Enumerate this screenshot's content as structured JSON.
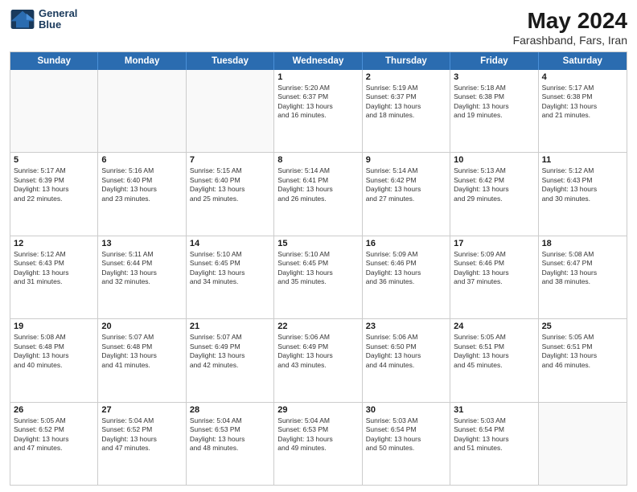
{
  "logo": {
    "line1": "General",
    "line2": "Blue"
  },
  "title": "May 2024",
  "location": "Farashband, Fars, Iran",
  "days_of_week": [
    "Sunday",
    "Monday",
    "Tuesday",
    "Wednesday",
    "Thursday",
    "Friday",
    "Saturday"
  ],
  "weeks": [
    [
      {
        "day": "",
        "info": ""
      },
      {
        "day": "",
        "info": ""
      },
      {
        "day": "",
        "info": ""
      },
      {
        "day": "1",
        "info": "Sunrise: 5:20 AM\nSunset: 6:37 PM\nDaylight: 13 hours\nand 16 minutes."
      },
      {
        "day": "2",
        "info": "Sunrise: 5:19 AM\nSunset: 6:37 PM\nDaylight: 13 hours\nand 18 minutes."
      },
      {
        "day": "3",
        "info": "Sunrise: 5:18 AM\nSunset: 6:38 PM\nDaylight: 13 hours\nand 19 minutes."
      },
      {
        "day": "4",
        "info": "Sunrise: 5:17 AM\nSunset: 6:38 PM\nDaylight: 13 hours\nand 21 minutes."
      }
    ],
    [
      {
        "day": "5",
        "info": "Sunrise: 5:17 AM\nSunset: 6:39 PM\nDaylight: 13 hours\nand 22 minutes."
      },
      {
        "day": "6",
        "info": "Sunrise: 5:16 AM\nSunset: 6:40 PM\nDaylight: 13 hours\nand 23 minutes."
      },
      {
        "day": "7",
        "info": "Sunrise: 5:15 AM\nSunset: 6:40 PM\nDaylight: 13 hours\nand 25 minutes."
      },
      {
        "day": "8",
        "info": "Sunrise: 5:14 AM\nSunset: 6:41 PM\nDaylight: 13 hours\nand 26 minutes."
      },
      {
        "day": "9",
        "info": "Sunrise: 5:14 AM\nSunset: 6:42 PM\nDaylight: 13 hours\nand 27 minutes."
      },
      {
        "day": "10",
        "info": "Sunrise: 5:13 AM\nSunset: 6:42 PM\nDaylight: 13 hours\nand 29 minutes."
      },
      {
        "day": "11",
        "info": "Sunrise: 5:12 AM\nSunset: 6:43 PM\nDaylight: 13 hours\nand 30 minutes."
      }
    ],
    [
      {
        "day": "12",
        "info": "Sunrise: 5:12 AM\nSunset: 6:43 PM\nDaylight: 13 hours\nand 31 minutes."
      },
      {
        "day": "13",
        "info": "Sunrise: 5:11 AM\nSunset: 6:44 PM\nDaylight: 13 hours\nand 32 minutes."
      },
      {
        "day": "14",
        "info": "Sunrise: 5:10 AM\nSunset: 6:45 PM\nDaylight: 13 hours\nand 34 minutes."
      },
      {
        "day": "15",
        "info": "Sunrise: 5:10 AM\nSunset: 6:45 PM\nDaylight: 13 hours\nand 35 minutes."
      },
      {
        "day": "16",
        "info": "Sunrise: 5:09 AM\nSunset: 6:46 PM\nDaylight: 13 hours\nand 36 minutes."
      },
      {
        "day": "17",
        "info": "Sunrise: 5:09 AM\nSunset: 6:46 PM\nDaylight: 13 hours\nand 37 minutes."
      },
      {
        "day": "18",
        "info": "Sunrise: 5:08 AM\nSunset: 6:47 PM\nDaylight: 13 hours\nand 38 minutes."
      }
    ],
    [
      {
        "day": "19",
        "info": "Sunrise: 5:08 AM\nSunset: 6:48 PM\nDaylight: 13 hours\nand 40 minutes."
      },
      {
        "day": "20",
        "info": "Sunrise: 5:07 AM\nSunset: 6:48 PM\nDaylight: 13 hours\nand 41 minutes."
      },
      {
        "day": "21",
        "info": "Sunrise: 5:07 AM\nSunset: 6:49 PM\nDaylight: 13 hours\nand 42 minutes."
      },
      {
        "day": "22",
        "info": "Sunrise: 5:06 AM\nSunset: 6:49 PM\nDaylight: 13 hours\nand 43 minutes."
      },
      {
        "day": "23",
        "info": "Sunrise: 5:06 AM\nSunset: 6:50 PM\nDaylight: 13 hours\nand 44 minutes."
      },
      {
        "day": "24",
        "info": "Sunrise: 5:05 AM\nSunset: 6:51 PM\nDaylight: 13 hours\nand 45 minutes."
      },
      {
        "day": "25",
        "info": "Sunrise: 5:05 AM\nSunset: 6:51 PM\nDaylight: 13 hours\nand 46 minutes."
      }
    ],
    [
      {
        "day": "26",
        "info": "Sunrise: 5:05 AM\nSunset: 6:52 PM\nDaylight: 13 hours\nand 47 minutes."
      },
      {
        "day": "27",
        "info": "Sunrise: 5:04 AM\nSunset: 6:52 PM\nDaylight: 13 hours\nand 47 minutes."
      },
      {
        "day": "28",
        "info": "Sunrise: 5:04 AM\nSunset: 6:53 PM\nDaylight: 13 hours\nand 48 minutes."
      },
      {
        "day": "29",
        "info": "Sunrise: 5:04 AM\nSunset: 6:53 PM\nDaylight: 13 hours\nand 49 minutes."
      },
      {
        "day": "30",
        "info": "Sunrise: 5:03 AM\nSunset: 6:54 PM\nDaylight: 13 hours\nand 50 minutes."
      },
      {
        "day": "31",
        "info": "Sunrise: 5:03 AM\nSunset: 6:54 PM\nDaylight: 13 hours\nand 51 minutes."
      },
      {
        "day": "",
        "info": ""
      }
    ]
  ]
}
